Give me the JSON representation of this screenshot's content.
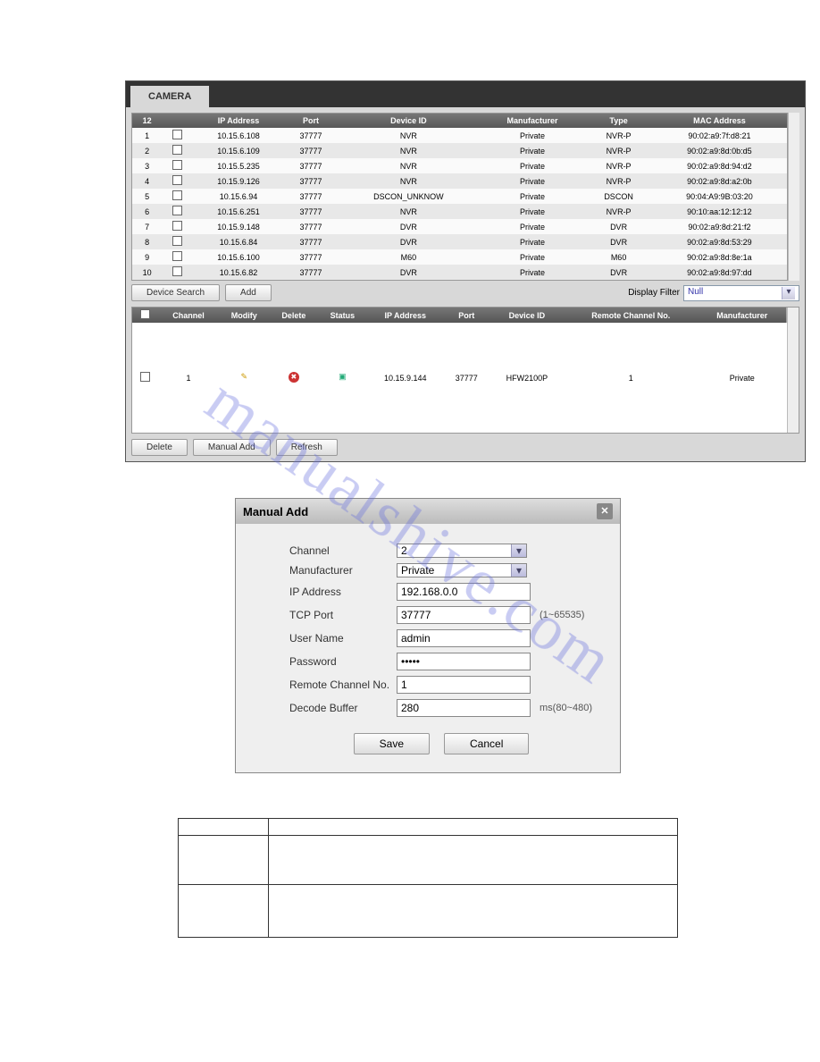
{
  "tab": "CAMERA",
  "searchTable": {
    "headers": [
      "12",
      "",
      "IP Address",
      "Port",
      "Device ID",
      "Manufacturer",
      "Type",
      "MAC Address"
    ],
    "rows": [
      {
        "n": "1",
        "ip": "10.15.6.108",
        "port": "37777",
        "dev": "NVR",
        "mfr": "Private",
        "type": "NVR-P",
        "mac": "90:02:a9:7f:d8:21"
      },
      {
        "n": "2",
        "ip": "10.15.6.109",
        "port": "37777",
        "dev": "NVR",
        "mfr": "Private",
        "type": "NVR-P",
        "mac": "90:02:a9:8d:0b:d5"
      },
      {
        "n": "3",
        "ip": "10.15.5.235",
        "port": "37777",
        "dev": "NVR",
        "mfr": "Private",
        "type": "NVR-P",
        "mac": "90:02:a9:8d:94:d2"
      },
      {
        "n": "4",
        "ip": "10.15.9.126",
        "port": "37777",
        "dev": "NVR",
        "mfr": "Private",
        "type": "NVR-P",
        "mac": "90:02:a9:8d:a2:0b"
      },
      {
        "n": "5",
        "ip": "10.15.6.94",
        "port": "37777",
        "dev": "DSCON_UNKNOW",
        "mfr": "Private",
        "type": "DSCON",
        "mac": "90:04:A9:9B:03:20"
      },
      {
        "n": "6",
        "ip": "10.15.6.251",
        "port": "37777",
        "dev": "NVR",
        "mfr": "Private",
        "type": "NVR-P",
        "mac": "90:10:aa:12:12:12"
      },
      {
        "n": "7",
        "ip": "10.15.9.148",
        "port": "37777",
        "dev": "DVR",
        "mfr": "Private",
        "type": "DVR",
        "mac": "90:02:a9:8d:21:f2"
      },
      {
        "n": "8",
        "ip": "10.15.6.84",
        "port": "37777",
        "dev": "DVR",
        "mfr": "Private",
        "type": "DVR",
        "mac": "90:02:a9:8d:53:29"
      },
      {
        "n": "9",
        "ip": "10.15.6.100",
        "port": "37777",
        "dev": "M60",
        "mfr": "Private",
        "type": "M60",
        "mac": "90:02:a9:8d:8e:1a"
      },
      {
        "n": "10",
        "ip": "10.15.6.82",
        "port": "37777",
        "dev": "DVR",
        "mfr": "Private",
        "type": "DVR",
        "mac": "90:02:a9:8d:97:dd"
      }
    ]
  },
  "buttons": {
    "search": "Device Search",
    "add": "Add",
    "delete": "Delete",
    "manual": "Manual Add",
    "refresh": "Refresh"
  },
  "filterLabel": "Display Filter",
  "filterValue": "Null",
  "addedTable": {
    "headers": [
      "",
      "Channel",
      "Modify",
      "Delete",
      "Status",
      "IP Address",
      "Port",
      "Device ID",
      "Remote Channel No.",
      "Manufacturer"
    ],
    "row": {
      "ch": "1",
      "ip": "10.15.9.144",
      "port": "37777",
      "dev": "HFW2100P",
      "rcn": "1",
      "mfr": "Private"
    }
  },
  "dialog": {
    "title": "Manual Add",
    "fields": {
      "channel": {
        "label": "Channel",
        "value": "2"
      },
      "mfr": {
        "label": "Manufacturer",
        "value": "Private"
      },
      "ip": {
        "label": "IP Address",
        "value": "192.168.0.0"
      },
      "tcp": {
        "label": "TCP Port",
        "value": "37777",
        "hint": "(1~65535)"
      },
      "user": {
        "label": "User Name",
        "value": "admin"
      },
      "pass": {
        "label": "Password",
        "value": "•••••"
      },
      "rcn": {
        "label": "Remote Channel No.",
        "value": "1"
      },
      "buf": {
        "label": "Decode Buffer",
        "value": "280",
        "hint": "ms(80~480)"
      }
    },
    "save": "Save",
    "cancel": "Cancel"
  },
  "watermark": "manualshive.com"
}
